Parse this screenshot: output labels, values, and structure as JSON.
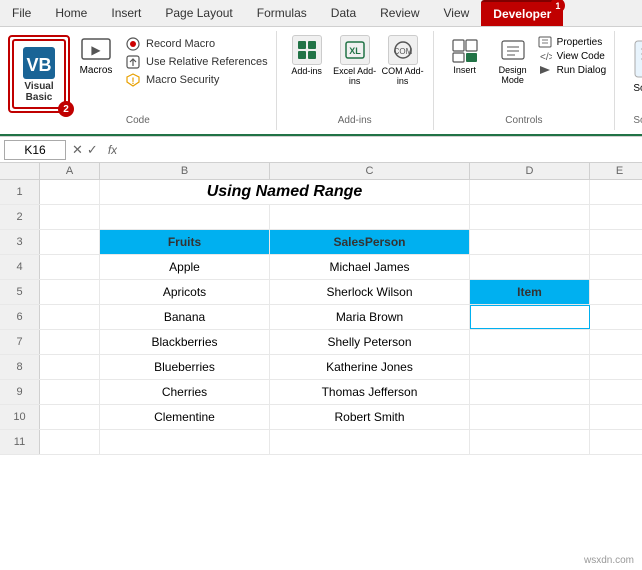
{
  "ribbon": {
    "tabs": [
      "File",
      "Home",
      "Insert",
      "Page Layout",
      "Formulas",
      "Data",
      "Review",
      "View",
      "Developer"
    ],
    "active_tab": "Developer",
    "developer_badge": "1",
    "groups": {
      "code": {
        "label": "Code",
        "vb_label": "Visual\nBasic",
        "vb_badge": "2",
        "macros_label": "Macros",
        "items": [
          {
            "icon": "record",
            "label": "Record Macro"
          },
          {
            "icon": "relative",
            "label": "Use Relative References"
          },
          {
            "icon": "security",
            "label": "Macro Security"
          }
        ]
      },
      "addins": {
        "label": "Add-ins",
        "buttons": [
          {
            "label": "Add-ins"
          },
          {
            "label": "Excel Add-ins"
          },
          {
            "label": "COM Add-ins"
          }
        ]
      },
      "controls": {
        "label": "Controls",
        "insert_label": "Insert",
        "design_label": "Design\nMode",
        "right_items": [
          {
            "label": "Properties"
          },
          {
            "label": "View Code"
          },
          {
            "label": "Run Dialog"
          }
        ]
      },
      "source": {
        "label": "Source",
        "button_label": "Source"
      }
    }
  },
  "formula_bar": {
    "name_box": "K16",
    "fx": "fx"
  },
  "sheet": {
    "title": "Using Named Range",
    "col_headers": [
      "",
      "A",
      "B",
      "C",
      "D",
      "E"
    ],
    "rows": [
      {
        "num": "1",
        "cells": [
          "",
          "",
          "",
          "",
          ""
        ]
      },
      {
        "num": "2",
        "cells": [
          "",
          "",
          "",
          "",
          ""
        ]
      },
      {
        "num": "3",
        "cells": [
          "",
          "Fruits",
          "SalesPerson",
          "",
          ""
        ]
      },
      {
        "num": "4",
        "cells": [
          "",
          "Apple",
          "Michael James",
          "",
          ""
        ]
      },
      {
        "num": "5",
        "cells": [
          "",
          "Apricots",
          "Sherlock Wilson",
          "Item",
          ""
        ]
      },
      {
        "num": "6",
        "cells": [
          "",
          "Banana",
          "Maria Brown",
          "",
          ""
        ]
      },
      {
        "num": "7",
        "cells": [
          "",
          "Blackberries",
          "Shelly Peterson",
          "",
          ""
        ]
      },
      {
        "num": "8",
        "cells": [
          "",
          "Blueberries",
          "Katherine Jones",
          "",
          ""
        ]
      },
      {
        "num": "9",
        "cells": [
          "",
          "Cherries",
          "Thomas Jefferson",
          "",
          ""
        ]
      },
      {
        "num": "10",
        "cells": [
          "",
          "Clementine",
          "Robert Smith",
          "",
          ""
        ]
      },
      {
        "num": "11",
        "cells": [
          "",
          "",
          "",
          "",
          ""
        ]
      }
    ]
  },
  "watermark": "wsxdn.com"
}
